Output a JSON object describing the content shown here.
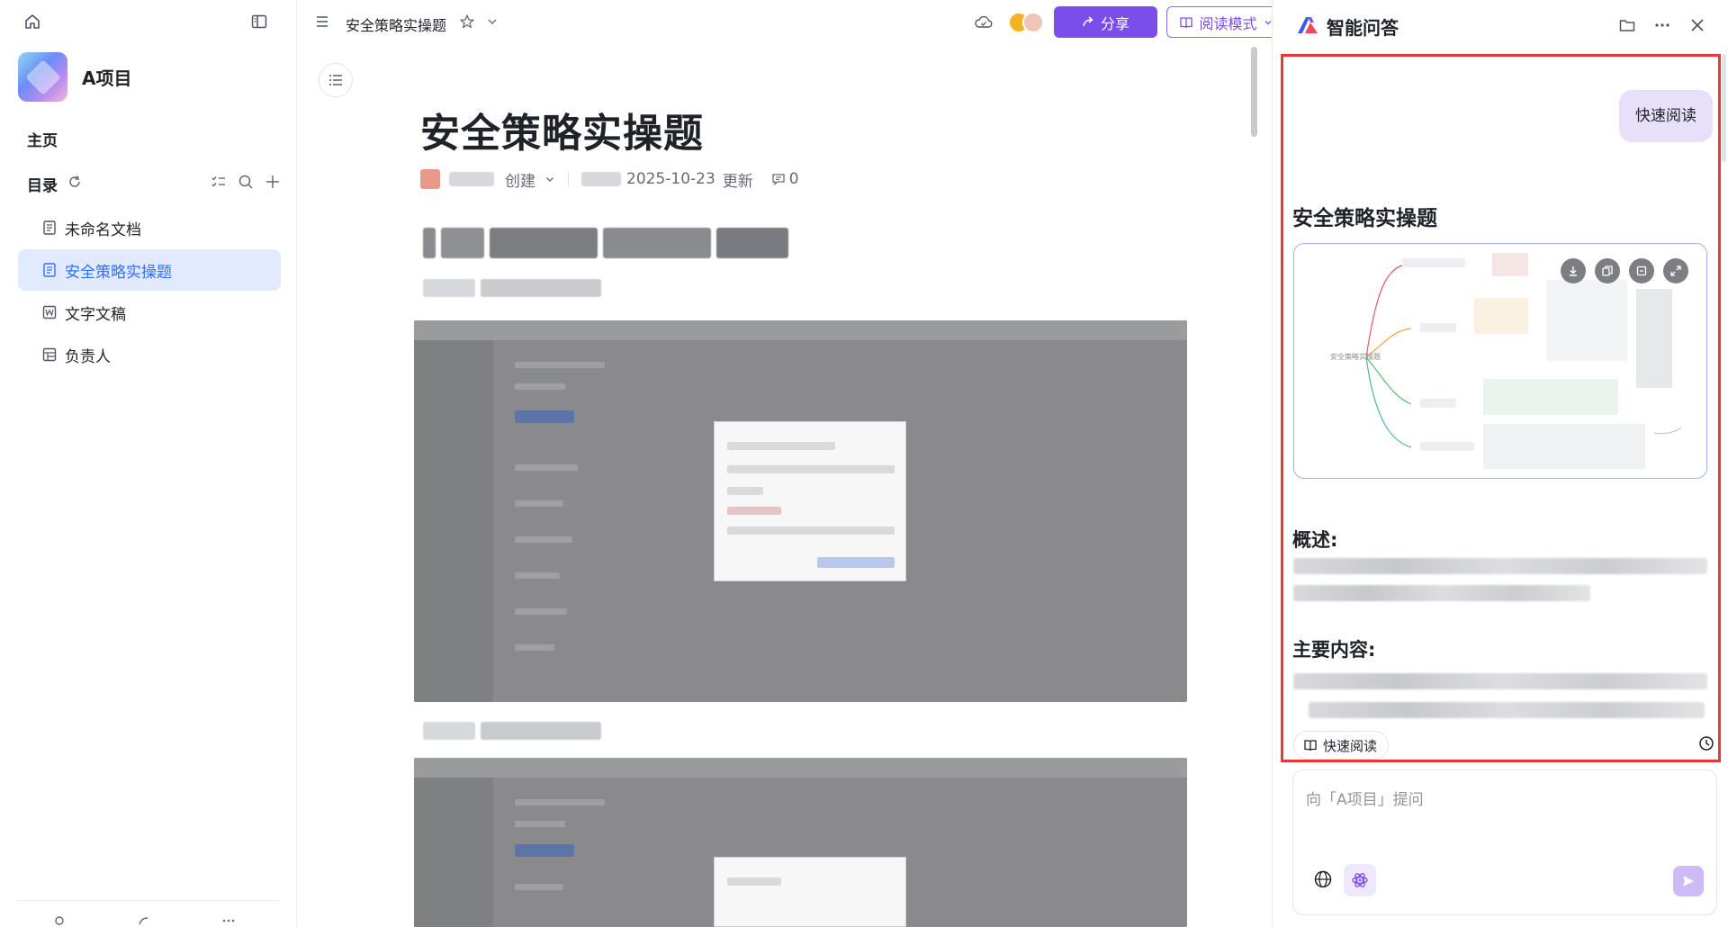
{
  "sidebar": {
    "project_name": "A项目",
    "home_label": "主页",
    "directory_label": "目录",
    "items": [
      {
        "label": "未命名文档",
        "icon": "doc-icon"
      },
      {
        "label": "安全策略实操题",
        "icon": "doc-icon"
      },
      {
        "label": "文字文稿",
        "icon": "word-icon"
      },
      {
        "label": "负责人",
        "icon": "table-icon"
      }
    ],
    "active_item": "安全策略实操题"
  },
  "header": {
    "breadcrumb": "安全策略实操题",
    "share_label": "分享",
    "read_mode_label": "阅读模式"
  },
  "document": {
    "title": "安全策略实操题",
    "created_label": "创建",
    "updated_date": "2025-10-23",
    "updated_label": "更新",
    "comment_count": "0"
  },
  "ai_panel": {
    "title": "智能问答",
    "user_message": "快速阅读",
    "answer_title": "安全策略实操题",
    "mindmap_root": "安全策略实操题",
    "overview_heading": "概述:",
    "main_content_heading": "主要内容:",
    "quick_read_chip": "快速阅读",
    "input_placeholder": "向「A项目」提问"
  },
  "colors": {
    "accent": "#7b4dea",
    "highlight_border": "#e5383b",
    "active_item_bg": "#e1eafe",
    "active_item_text": "#3370ff"
  }
}
